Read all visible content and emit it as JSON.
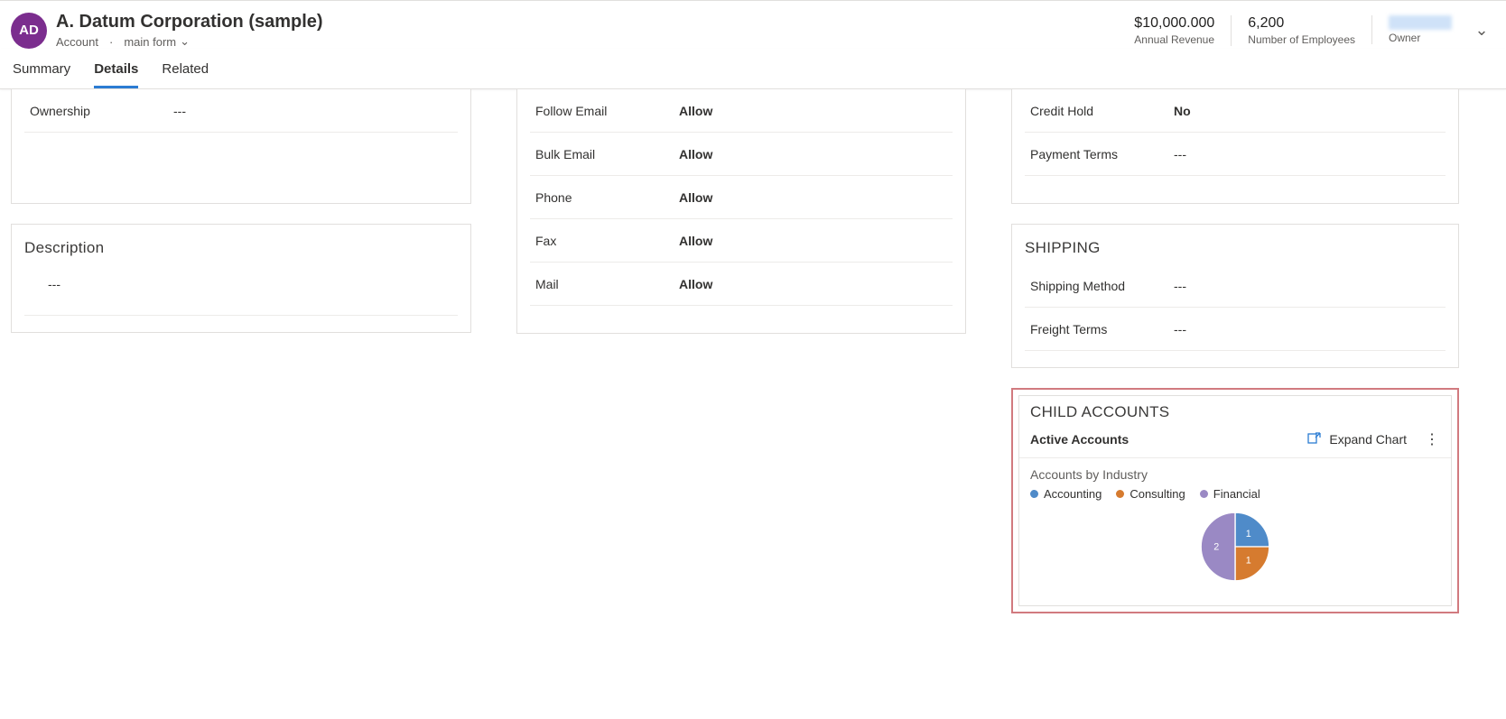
{
  "header": {
    "avatar_initials": "AD",
    "title": "A. Datum Corporation (sample)",
    "entity_label": "Account",
    "form_label": "main form",
    "metrics": [
      {
        "value": "$10,000.000",
        "label": "Annual Revenue"
      },
      {
        "value": "6,200",
        "label": "Number of Employees"
      }
    ],
    "owner_label": "Owner"
  },
  "tabs": [
    {
      "label": "Summary",
      "active": false
    },
    {
      "label": "Details",
      "active": true
    },
    {
      "label": "Related",
      "active": false
    }
  ],
  "left": {
    "ownership": {
      "label": "Ownership",
      "value": "---"
    },
    "description": {
      "title": "Description",
      "value": "---"
    }
  },
  "mid": {
    "rows": [
      {
        "label": "Follow Email",
        "value": "Allow"
      },
      {
        "label": "Bulk Email",
        "value": "Allow"
      },
      {
        "label": "Phone",
        "value": "Allow"
      },
      {
        "label": "Fax",
        "value": "Allow"
      },
      {
        "label": "Mail",
        "value": "Allow"
      }
    ]
  },
  "right": {
    "top_rows": [
      {
        "label": "Credit Hold",
        "value": "No",
        "bold": true
      },
      {
        "label": "Payment Terms",
        "value": "---",
        "bold": false
      }
    ],
    "shipping": {
      "title": "SHIPPING",
      "rows": [
        {
          "label": "Shipping Method",
          "value": "---"
        },
        {
          "label": "Freight Terms",
          "value": "---"
        }
      ]
    },
    "child_accounts": {
      "title": "CHILD ACCOUNTS",
      "subtitle": "Active Accounts",
      "expand_label": "Expand Chart"
    }
  },
  "chart_data": {
    "type": "pie",
    "title": "Accounts by Industry",
    "series": [
      {
        "name": "Accounting",
        "value": 1,
        "color": "#4f8bc9"
      },
      {
        "name": "Consulting",
        "value": 1,
        "color": "#d67b2f"
      },
      {
        "name": "Financial",
        "value": 2,
        "color": "#9a89c4"
      }
    ]
  }
}
